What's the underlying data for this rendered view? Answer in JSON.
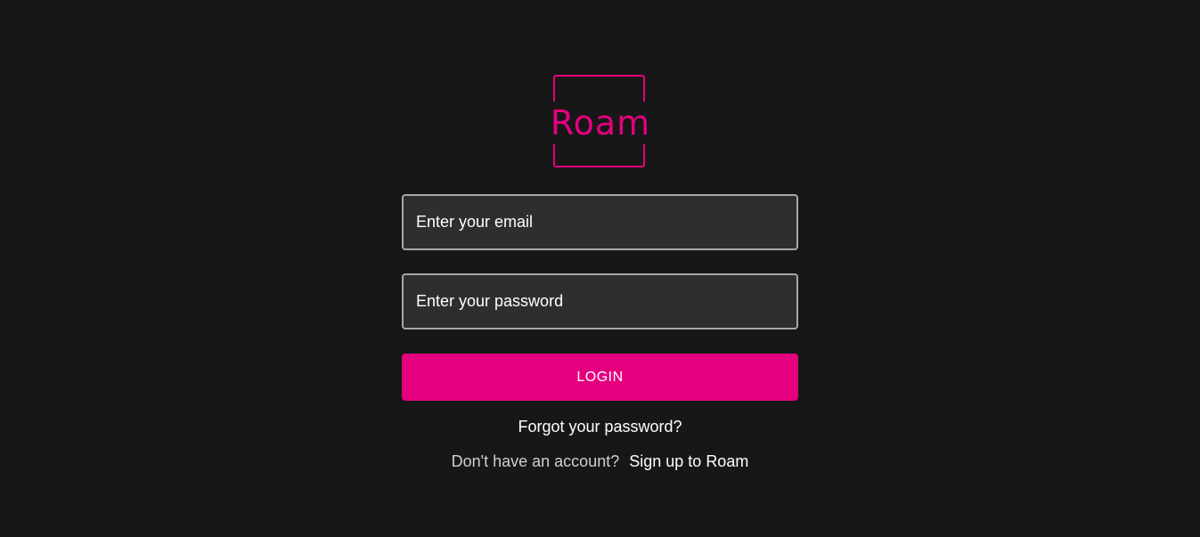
{
  "brand": {
    "name": "Roam",
    "accent_color": "#e4007f"
  },
  "login_form": {
    "email_placeholder": "Enter your email",
    "password_placeholder": "Enter your password",
    "login_label": "LOGIN",
    "forgot_password_label": "Forgot your password?",
    "signup_prompt": "Don't have an account?",
    "signup_link_label": "Sign up to Roam"
  }
}
